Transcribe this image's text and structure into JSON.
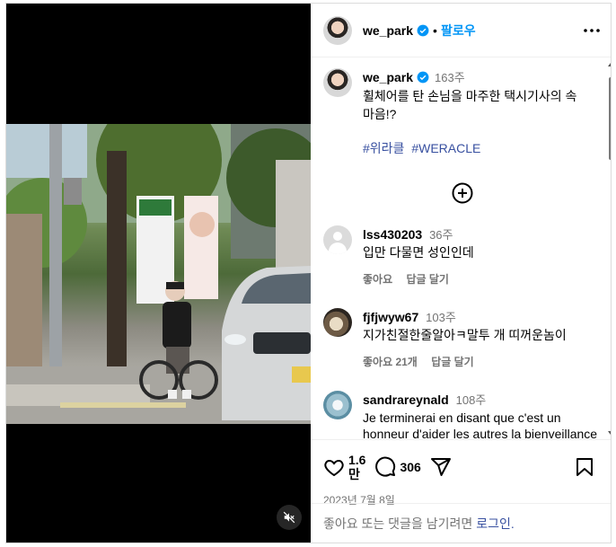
{
  "header": {
    "username": "we_park",
    "separator": "•",
    "follow_label": "팔로우"
  },
  "caption": {
    "username": "we_park",
    "time": "163주",
    "text": "휠체어를 탄 손님을 마주한 택시기사의 속마음!?",
    "hashtags": [
      "#위라클",
      "#WERACLE"
    ]
  },
  "comments": [
    {
      "username": "lss430203",
      "time": "36주",
      "text": "입만 다물면 성인인데",
      "like_label": "좋아요",
      "reply_label": "답글 달기"
    },
    {
      "username": "fjfjwyw67",
      "time": "103주",
      "text": "지가친절한줄알아ㅋ말투 개 띠꺼운놈이",
      "like_label": "좋아요 21개",
      "reply_label": "답글 달기"
    },
    {
      "username": "sandrareynald",
      "time": "108주",
      "text": "Je terminerai en disant que c'est un honneur d'aider les autres la bienveillance est importante"
    }
  ],
  "actions": {
    "likes_line1": "1.6",
    "likes_line2": "만",
    "comments_count": "306"
  },
  "date": "2023년 7월 8일",
  "login_prompt": {
    "text": "좋아요 또는 댓글을 남기려면",
    "link": "로그인."
  },
  "icons": {
    "verified": "verified-badge-icon",
    "more": "more-horizontal-icon",
    "load_more": "plus-circle-icon",
    "like": "heart-icon",
    "comment": "comment-bubble-icon",
    "share": "paper-plane-icon",
    "save": "bookmark-icon",
    "mute": "speaker-muted-icon"
  },
  "colors": {
    "accent": "#0095f6",
    "hashtag": "#3850a0",
    "muted": "#737373"
  }
}
